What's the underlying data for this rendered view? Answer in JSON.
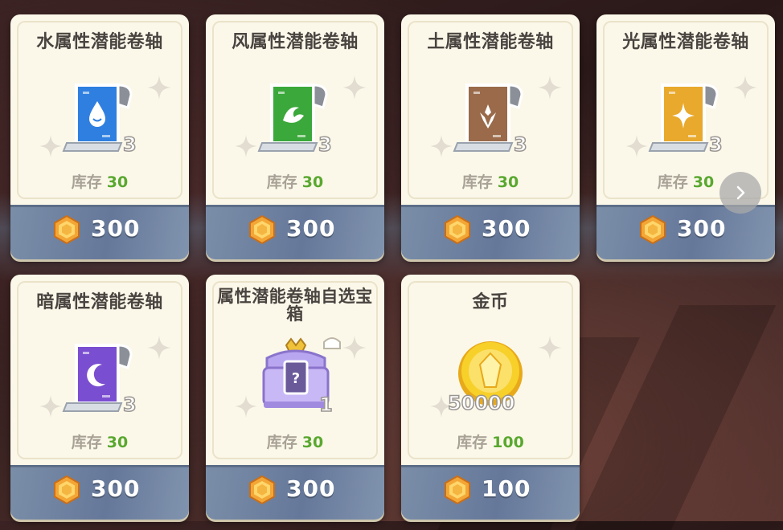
{
  "shop": {
    "items": [
      {
        "title": "水属性潜能卷轴",
        "stock_label": "库存",
        "stock": "30",
        "count": "3",
        "price": "300",
        "icon": "water-scroll-icon",
        "color": "#2f7fe0"
      },
      {
        "title": "风属性潜能卷轴",
        "stock_label": "库存",
        "stock": "30",
        "count": "3",
        "price": "300",
        "icon": "wind-scroll-icon",
        "color": "#3aa83a"
      },
      {
        "title": "土属性潜能卷轴",
        "stock_label": "库存",
        "stock": "30",
        "count": "3",
        "price": "300",
        "icon": "earth-scroll-icon",
        "color": "#9a6a4a"
      },
      {
        "title": "光属性潜能卷轴",
        "stock_label": "库存",
        "stock": "30",
        "count": "3",
        "price": "300",
        "icon": "light-scroll-icon",
        "color": "#e8a92c"
      },
      {
        "title": "暗属性潜能卷轴",
        "stock_label": "库存",
        "stock": "30",
        "count": "3",
        "price": "300",
        "icon": "dark-scroll-icon",
        "color": "#7a4ed0"
      },
      {
        "title": "属性潜能卷轴自选宝箱",
        "stock_label": "库存",
        "stock": "30",
        "count": "1",
        "price": "300",
        "icon": "selection-chest-icon",
        "color": "#a98ee8"
      },
      {
        "title": "金币",
        "stock_label": "库存",
        "stock": "100",
        "count": "50000",
        "price": "100",
        "icon": "gold-coin-icon",
        "color": "#f4c21c"
      }
    ],
    "currency_icon": "hexagon-gem-icon",
    "next_icon": "chevron-right-icon"
  }
}
